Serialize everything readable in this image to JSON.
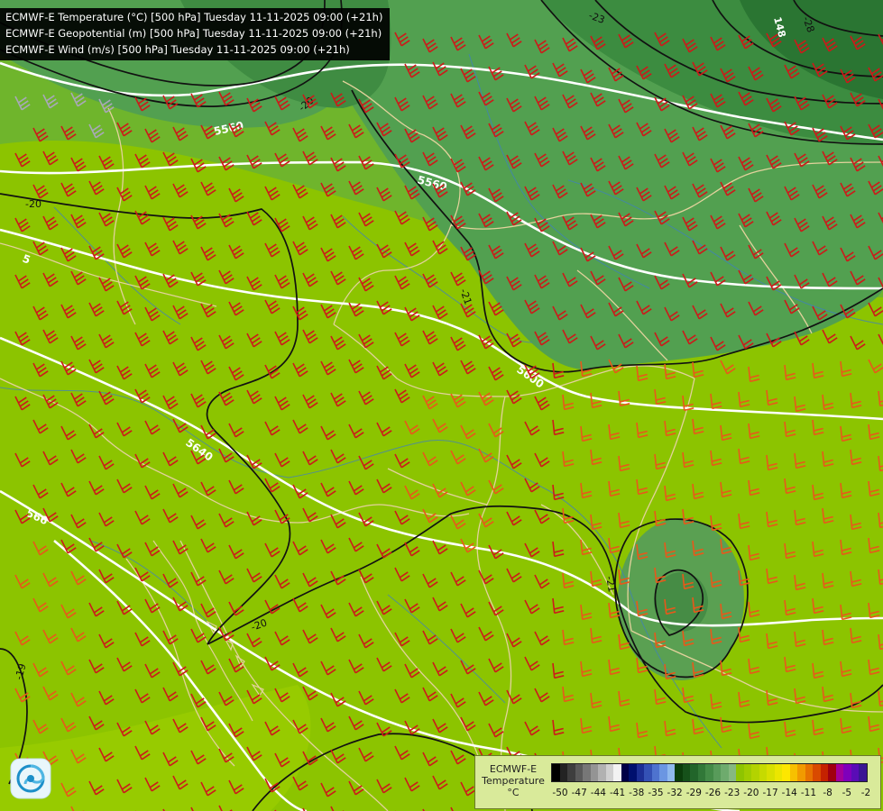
{
  "header": {
    "lines": [
      "ECMWF-E Temperature (°C) [500 hPa] Tuesday 11-11-2025 09:00 (+21h)",
      "ECMWF-E Geopotential (m) [500 hPa] Tuesday 11-11-2025 09:00 (+21h)",
      "ECMWF-E Wind (m/s) [500 hPa] Tuesday 11-11-2025 09:00 (+21h)"
    ]
  },
  "contour_labels": {
    "geopotential": [
      "5560",
      "5560",
      "5600",
      "5640",
      "566",
      "5"
    ],
    "temperature": [
      "-23",
      "-28",
      "-20",
      "-20",
      "-21",
      "-19",
      "-21",
      "-20"
    ],
    "partial_top": [
      "148"
    ]
  },
  "legend": {
    "title_line1": "ECMWF-E",
    "title_line2": "Temperature",
    "unit": "°C",
    "colors": [
      "#000000",
      "#232323",
      "#3e3e3e",
      "#5a5a5a",
      "#777777",
      "#949494",
      "#b1b1b1",
      "#d0d0d0",
      "#f2f2f2",
      "#000046",
      "#00106e",
      "#1c2f95",
      "#3451b5",
      "#4e73cf",
      "#6b96e2",
      "#8fb9ee",
      "#0b3d0b",
      "#16511a",
      "#22652a",
      "#317838",
      "#438b47",
      "#589b5a",
      "#6eab6d",
      "#86b880",
      "#8ec400",
      "#a0cc00",
      "#b3d300",
      "#c6da00",
      "#d8e000",
      "#ebe600",
      "#fde700",
      "#f7c000",
      "#f19a00",
      "#e77200",
      "#d94a00",
      "#c52200",
      "#a0000f",
      "#a4009a",
      "#7f00bb",
      "#5a0cb6",
      "#3a1693"
    ],
    "ticks": [
      "-50",
      "-47",
      "-44",
      "-41",
      "-38",
      "-35",
      "-32",
      "-29",
      "-26",
      "-23",
      "-20",
      "-17",
      "-14",
      "-11",
      "-8",
      "-5",
      "-2"
    ]
  },
  "colors": {
    "field_warm": "#8cc400",
    "field_mid": "#6db52e",
    "field_cool": "#52a050",
    "field_cold": "#2e7a3a",
    "geopotential_lines": "#ffffff",
    "temperature_lines": "#000000",
    "borders": "#e3d29c",
    "rivers": "#3f7fc0",
    "barb_strong": "#cc1a1a",
    "barb_medium": "#e8581a",
    "barb_weak": "#a8a8b8"
  },
  "icons": [
    "ecmwf-logo-icon"
  ]
}
